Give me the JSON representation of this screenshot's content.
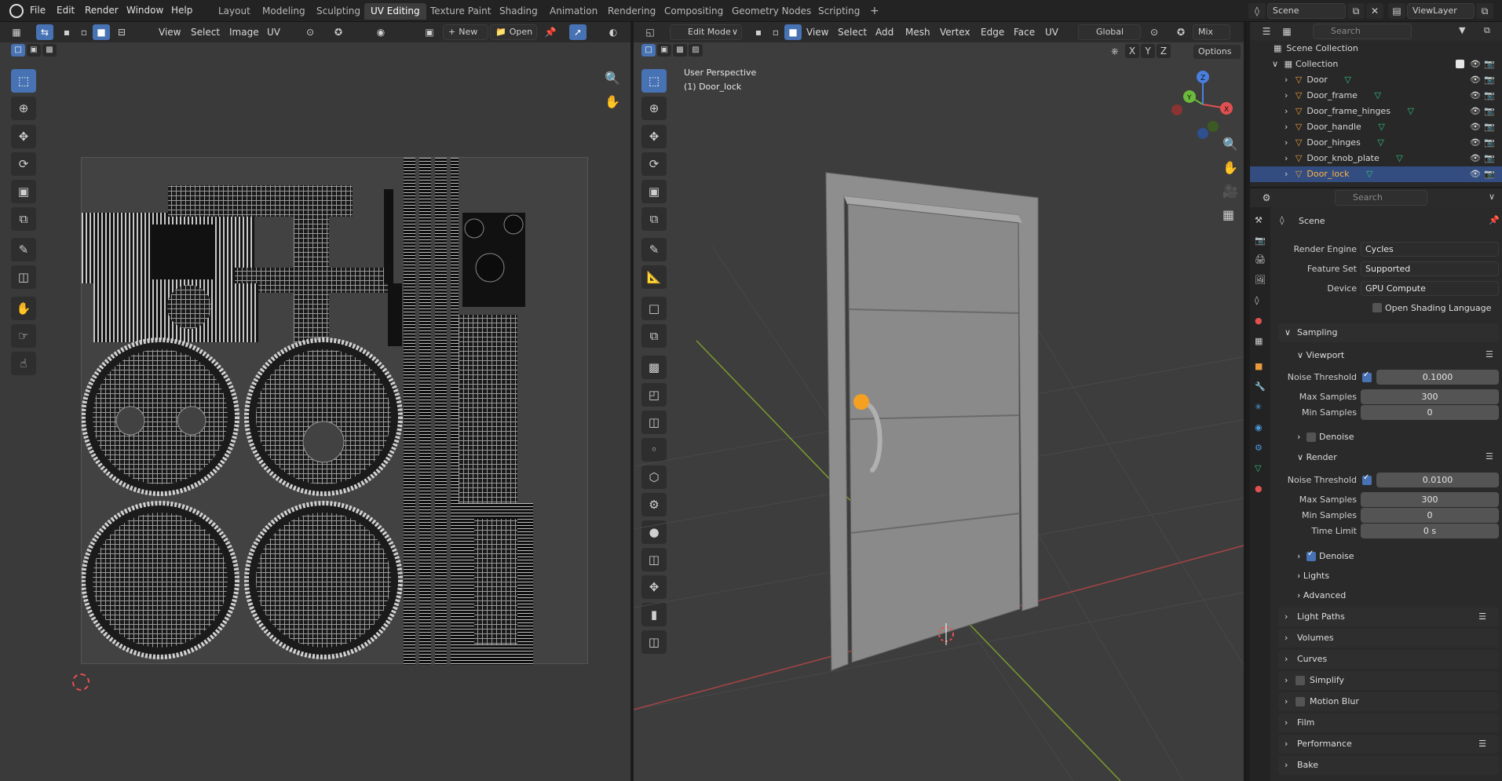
{
  "topbar": {
    "menus": [
      "File",
      "Edit",
      "Render",
      "Window",
      "Help"
    ],
    "workspaces": [
      "Layout",
      "Modeling",
      "Sculpting",
      "UV Editing",
      "Texture Paint",
      "Shading",
      "Animation",
      "Rendering",
      "Compositing",
      "Geometry Nodes",
      "Scripting"
    ],
    "active_workspace": "UV Editing",
    "add_tab": "+",
    "scene_name": "Scene",
    "viewlayer_name": "ViewLayer"
  },
  "uv_editor": {
    "menus": [
      "View",
      "Select",
      "Image",
      "UV"
    ],
    "new_label": "New",
    "open_label": "Open"
  },
  "viewport": {
    "mode": "Edit Mode",
    "menus": [
      "View",
      "Select",
      "Add",
      "Mesh",
      "Vertex",
      "Edge",
      "Face",
      "UV"
    ],
    "transform_orientation": "Global",
    "proportional_mode": "Mix",
    "options_label": "Options",
    "axis_x": "X",
    "axis_y": "Y",
    "axis_z": "Z",
    "perspective_label": "User Perspective",
    "object_label": "(1) Door_lock",
    "gizmo_labels": {
      "x": "X",
      "y": "Y",
      "z": "Z"
    }
  },
  "outliner": {
    "search_placeholder": "Search",
    "root": "Scene Collection",
    "collection": "Collection",
    "objects": [
      "Door",
      "Door_frame",
      "Door_frame_hinges",
      "Door_handle",
      "Door_hinges",
      "Door_knob_plate",
      "Door_lock"
    ],
    "selected": "Door_lock"
  },
  "properties": {
    "search_placeholder": "Search",
    "context": "Scene",
    "render_engine_label": "Render Engine",
    "render_engine": "Cycles",
    "feature_set_label": "Feature Set",
    "feature_set": "Supported",
    "device_label": "Device",
    "device": "GPU Compute",
    "osl_label": "Open Shading Language",
    "sampling": "Sampling",
    "viewport": "Viewport",
    "vp_noise_label": "Noise Threshold",
    "vp_noise": "0.1000",
    "vp_max_label": "Max Samples",
    "vp_max": "300",
    "vp_min_label": "Min Samples",
    "vp_min": "0",
    "vp_denoise": "Denoise",
    "render": "Render",
    "r_noise_label": "Noise Threshold",
    "r_noise": "0.0100",
    "r_max_label": "Max Samples",
    "r_max": "300",
    "r_min_label": "Min Samples",
    "r_min": "0",
    "r_time_label": "Time Limit",
    "r_time": "0 s",
    "r_denoise": "Denoise",
    "lights": "Lights",
    "advanced": "Advanced",
    "panels": [
      "Light Paths",
      "Volumes",
      "Curves",
      "Simplify",
      "Motion Blur",
      "Film",
      "Performance",
      "Bake"
    ]
  },
  "colors": {
    "accent": "#4772b3",
    "selected_row": "#334d80",
    "object_orange": "#e89a3c",
    "vertex_group_green": "#2ec27e"
  }
}
